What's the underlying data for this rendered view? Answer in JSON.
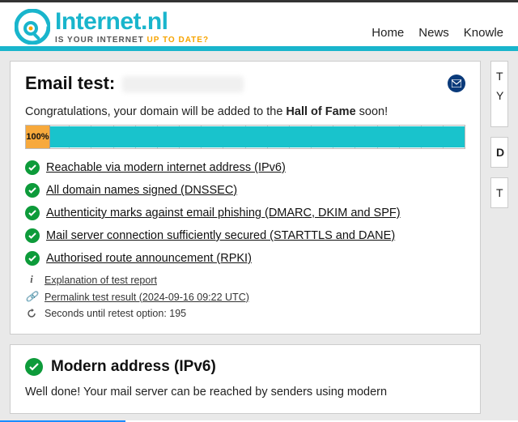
{
  "brand": {
    "name": "Internet.nl",
    "tagline1": "IS YOUR INTERNET ",
    "tagline2": "UP TO DATE?"
  },
  "nav": {
    "home": "Home",
    "news": "News",
    "knowledge": "Knowle"
  },
  "test": {
    "title_prefix": "Email test: ",
    "congrats_pre": "Congratulations, your domain will be added to the ",
    "congrats_bold": "Hall of Fame",
    "congrats_post": " soon!",
    "score": "100%",
    "checks": [
      "Reachable via modern internet address (IPv6)",
      "All domain names signed (DNSSEC)",
      "Authenticity marks against email phishing (DMARC, DKIM and SPF)",
      "Mail server connection sufficiently secured (STARTTLS and DANE)",
      "Authorised route announcement (RPKI)"
    ],
    "meta": {
      "explanation": "Explanation of test report",
      "permalink": "Permalink test result (2024-09-16 09:22 UTC)",
      "retest": "Seconds until retest option: 195"
    }
  },
  "section2": {
    "title": "Modern address (IPv6)",
    "body": "Well done! Your mail server can be reached by senders using modern"
  },
  "side": {
    "c1": "T",
    "c1b": "Y",
    "c2": "D",
    "c3": "T"
  }
}
